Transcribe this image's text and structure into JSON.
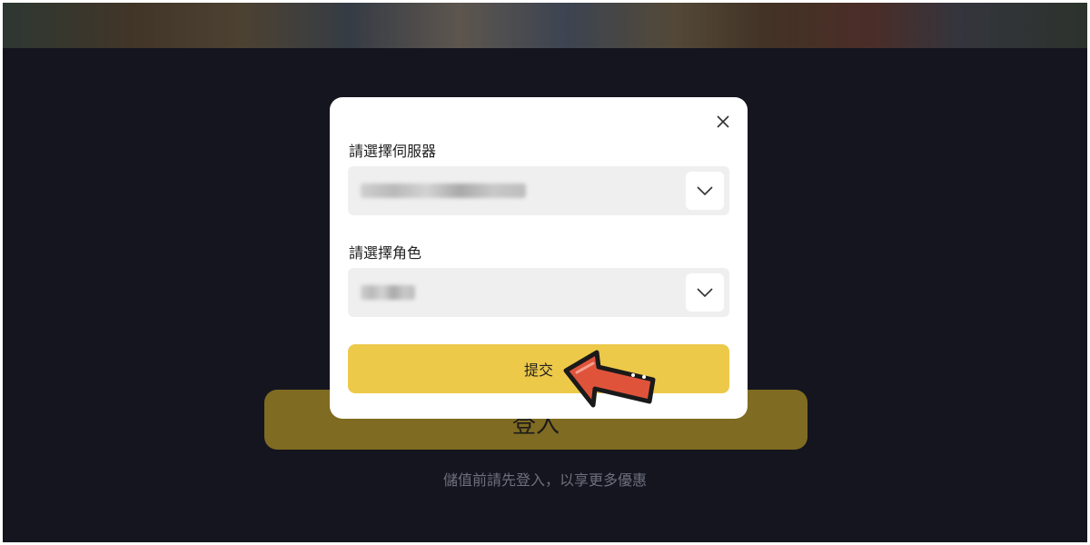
{
  "page": {
    "login_button": "登入",
    "hint": "儲值前請先登入，以享更多優惠"
  },
  "modal": {
    "server_label": "請選擇伺服器",
    "role_label": "請選擇角色",
    "submit_label": "提交"
  },
  "colors": {
    "background": "#14151f",
    "modal": "#ffffff",
    "submit": "#edc94a",
    "login_dim": "#7f6b21",
    "arrow": "#e0533b"
  },
  "icons": {
    "close": "close-icon",
    "dropdown": "chevron-down-icon",
    "pointer": "arrow-pointer-icon"
  }
}
